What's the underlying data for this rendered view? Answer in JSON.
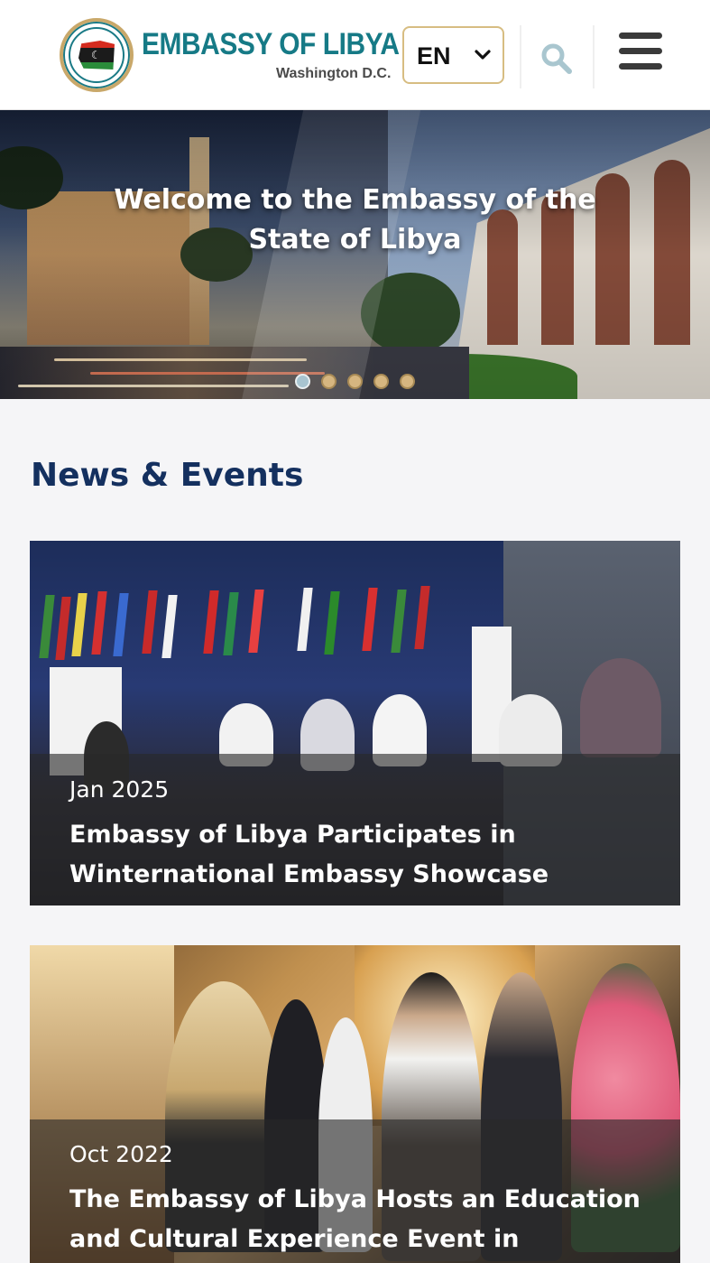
{
  "header": {
    "logo_alt": "EMBASSY OF THE STATE OF LIBYA · WASHINGTON D.C.",
    "title": "EMBASSY OF LIBYA",
    "subtitle": "Washington D.C.",
    "language": {
      "selected": "EN"
    },
    "icons": [
      "search-icon",
      "menu-icon",
      "chevron-down-icon"
    ]
  },
  "hero": {
    "title": "Welcome to the Embassy of the State of Libya",
    "slides": [
      1,
      2,
      3,
      4,
      5
    ],
    "active_slide": 1
  },
  "news": {
    "heading": "News & Events",
    "items": [
      {
        "date": "Jan 2025",
        "title": "Embassy of Libya Participates in Winternational Embassy Showcase"
      },
      {
        "date": "Oct 2022",
        "title": "The Embassy of Libya Hosts an Education and Cultural Experience Event in"
      }
    ]
  },
  "colors": {
    "brand_teal": "#167a86",
    "brand_gold": "#d7bd82",
    "heading_navy": "#14305f"
  }
}
